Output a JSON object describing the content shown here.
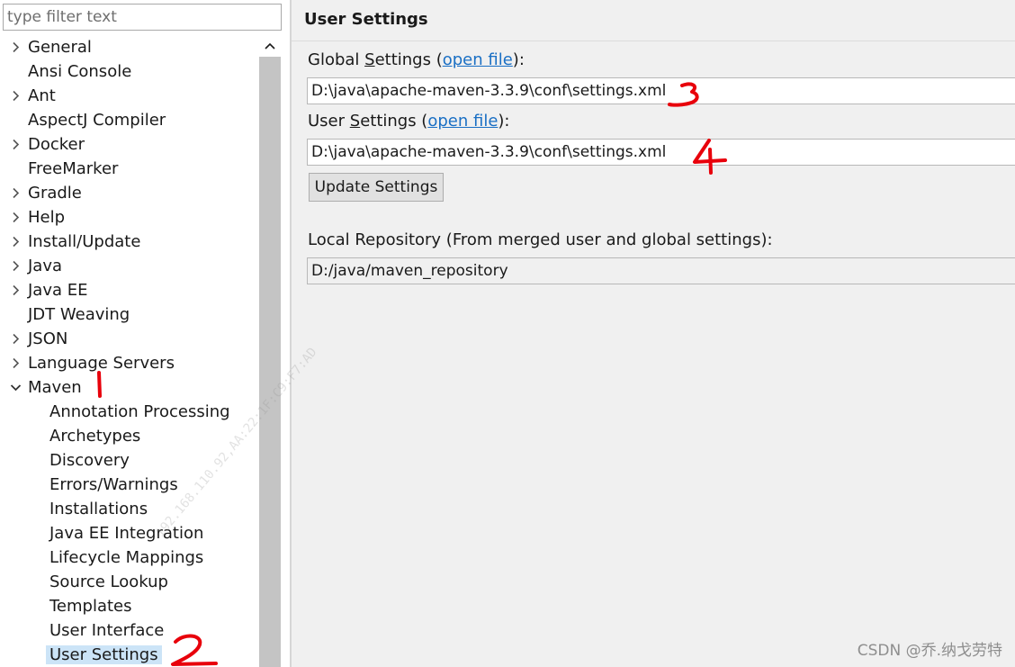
{
  "filter": {
    "placeholder": "type filter text",
    "value": ""
  },
  "tree": {
    "items": [
      {
        "label": "General",
        "expander": "collapsed"
      },
      {
        "label": "Ansi Console",
        "expander": "none"
      },
      {
        "label": "Ant",
        "expander": "collapsed"
      },
      {
        "label": "AspectJ Compiler",
        "expander": "none"
      },
      {
        "label": "Docker",
        "expander": "collapsed"
      },
      {
        "label": "FreeMarker",
        "expander": "none"
      },
      {
        "label": "Gradle",
        "expander": "collapsed"
      },
      {
        "label": "Help",
        "expander": "collapsed"
      },
      {
        "label": "Install/Update",
        "expander": "collapsed"
      },
      {
        "label": "Java",
        "expander": "collapsed"
      },
      {
        "label": "Java EE",
        "expander": "collapsed"
      },
      {
        "label": "JDT Weaving",
        "expander": "none"
      },
      {
        "label": "JSON",
        "expander": "collapsed"
      },
      {
        "label": "Language Servers",
        "expander": "collapsed"
      },
      {
        "label": "Maven",
        "expander": "expanded"
      }
    ],
    "maven_children": [
      "Annotation Processing",
      "Archetypes",
      "Discovery",
      "Errors/Warnings",
      "Installations",
      "Java EE Integration",
      "Lifecycle Mappings",
      "Source Lookup",
      "Templates",
      "User Interface",
      "User Settings"
    ],
    "selected": "User Settings"
  },
  "page": {
    "title": "User Settings",
    "global_settings": {
      "label_prefix": "Global ",
      "label_mnemonic": "S",
      "label_rest": "ettings (",
      "link_text": "open file",
      "label_suffix": "):",
      "value": "D:\\java\\apache-maven-3.3.9\\conf\\settings.xml"
    },
    "user_settings": {
      "label_prefix": "User ",
      "label_mnemonic": "S",
      "label_rest": "ettings (",
      "link_text": "open file",
      "label_suffix": "):",
      "value": "D:\\java\\apache-maven-3.3.9\\conf\\settings.xml"
    },
    "update_button": "Update Settings",
    "local_repository": {
      "label": "Local Repository (From merged user and global settings):",
      "value": "D:/java/maven_repository"
    }
  },
  "icons": {
    "collapsed": "chevron-right-icon",
    "expanded": "chevron-down-icon",
    "scroll_up": "chevron-up-icon"
  },
  "colors": {
    "link": "#1a6fc4",
    "selection": "#cce4f7",
    "annotation": "#e8000b",
    "scroll_thumb": "#c4c4c4"
  },
  "watermark": {
    "text": "192.168.110.92,AA:22:1F:C9:F7:AD",
    "credit": "CSDN @乔.纳戈劳特"
  }
}
